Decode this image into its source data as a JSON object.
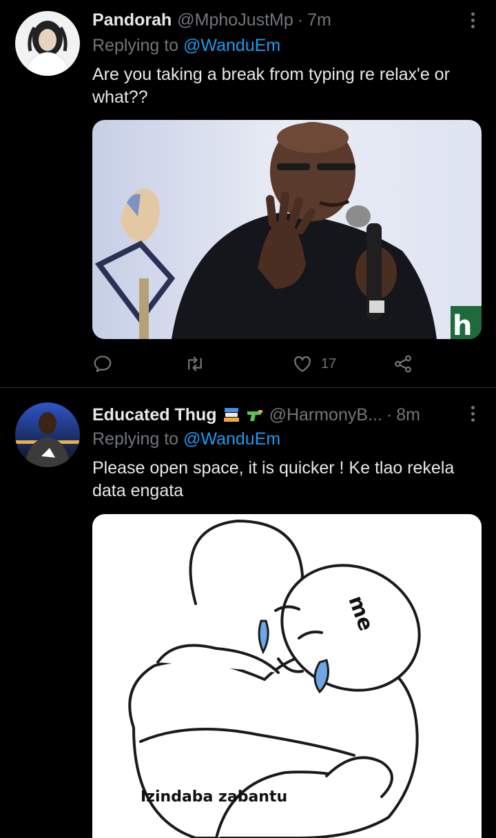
{
  "tweets": [
    {
      "display_name": "Pandorah",
      "handle": "@MphoJustMp",
      "separator": "·",
      "time": "7m",
      "replying_prefix": "Replying to ",
      "replying_to": "@WanduEm",
      "text": "Are you taking a break from typing re relax'e or what??",
      "actions": {
        "reply_icon": "comment-icon",
        "retweet_icon": "retweet-icon",
        "like_icon": "heart-icon",
        "like_count": "17",
        "share_icon": "share-icon"
      }
    },
    {
      "display_name": "Educated Thug",
      "name_emojis": [
        "books-emoji",
        "water-pistol-emoji"
      ],
      "handle": "@HarmonyB...",
      "separator": "·",
      "time": "8m",
      "replying_prefix": "Replying to ",
      "replying_to": "@WanduEm",
      "text": "Please open space,  it is quicker ! Ke tlao rekela data engata",
      "meme": {
        "label_head": "me",
        "caption": "Izindaba zabantu"
      }
    }
  ],
  "colors": {
    "background": "#000000",
    "primary_text": "#e7e9ea",
    "secondary_text": "#71767b",
    "accent": "#1d9bf0",
    "divider": "#2f3336"
  }
}
